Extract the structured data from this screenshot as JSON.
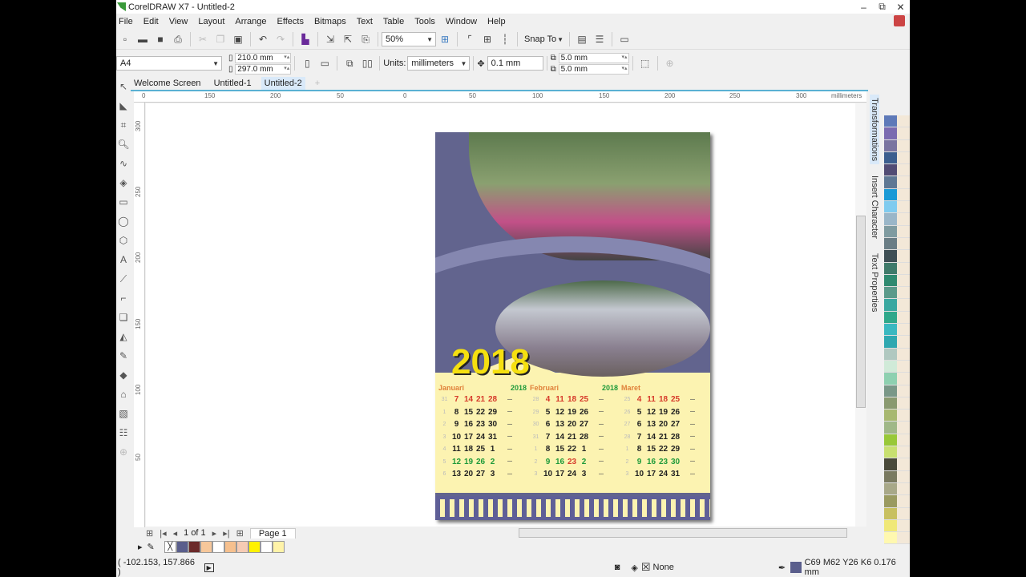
{
  "window": {
    "title": "CorelDRAW X7 - Untitled-2",
    "minimize": "–",
    "restore": "⧉",
    "close": "✕"
  },
  "menu": [
    "File",
    "Edit",
    "View",
    "Layout",
    "Arrange",
    "Effects",
    "Bitmaps",
    "Text",
    "Table",
    "Tools",
    "Window",
    "Help"
  ],
  "toolbar": {
    "zoom_value": "50%",
    "snap_label": "Snap To"
  },
  "property_bar": {
    "page_size": "A4",
    "width": "210.0 mm",
    "height": "297.0 mm",
    "units_label": "Units:",
    "units_value": "millimeters",
    "nudge": "0.1 mm",
    "dup_x": "5.0 mm",
    "dup_y": "5.0 mm"
  },
  "tabs": [
    {
      "label": "Welcome Screen"
    },
    {
      "label": "Untitled-1"
    },
    {
      "label": "Untitled-2"
    }
  ],
  "ruler": {
    "h_ticks": [
      "0",
      "150",
      "200",
      "50",
      "0",
      "50",
      "100",
      "150",
      "200",
      "250",
      "300"
    ],
    "units": "millimeters",
    "v_ticks": [
      "300",
      "250",
      "200",
      "150",
      "100",
      "50"
    ]
  },
  "calendar": {
    "year": "2018",
    "months": [
      {
        "name": "Januari",
        "yr": "2018",
        "rows": [
          [
            "31",
            "7",
            "14",
            "21",
            "28"
          ],
          [
            "1",
            "8",
            "15",
            "22",
            "29"
          ],
          [
            "2",
            "9",
            "16",
            "23",
            "30"
          ],
          [
            "3",
            "10",
            "17",
            "24",
            "31"
          ],
          [
            "4",
            "11",
            "18",
            "25",
            "1"
          ],
          [
            "5",
            "12",
            "19",
            "26",
            "2"
          ],
          [
            "6",
            "13",
            "20",
            "27",
            "3"
          ]
        ]
      },
      {
        "name": "Februari",
        "yr": "2018",
        "rows": [
          [
            "28",
            "4",
            "11",
            "18",
            "25"
          ],
          [
            "29",
            "5",
            "12",
            "19",
            "26"
          ],
          [
            "30",
            "6",
            "13",
            "20",
            "27"
          ],
          [
            "31",
            "7",
            "14",
            "21",
            "28"
          ],
          [
            "1",
            "8",
            "15",
            "22",
            "1"
          ],
          [
            "2",
            "9",
            "16",
            "23",
            "2"
          ],
          [
            "3",
            "10",
            "17",
            "24",
            "3"
          ]
        ]
      },
      {
        "name": "Maret",
        "yr": "",
        "rows": [
          [
            "25",
            "4",
            "11",
            "18",
            "25"
          ],
          [
            "26",
            "5",
            "12",
            "19",
            "26"
          ],
          [
            "27",
            "6",
            "13",
            "20",
            "27"
          ],
          [
            "28",
            "7",
            "14",
            "21",
            "28"
          ],
          [
            "1",
            "8",
            "15",
            "22",
            "29"
          ],
          [
            "2",
            "9",
            "16",
            "23",
            "30"
          ],
          [
            "3",
            "10",
            "17",
            "24",
            "31"
          ]
        ]
      }
    ]
  },
  "pager": {
    "count": "1 of 1",
    "page_tab": "Page 1"
  },
  "doc_palette": [
    "none",
    "#5a5e8c",
    "#6b2a2a",
    "#f6c79a",
    "#ffffff",
    "#f6c08e",
    "#f6cbb4",
    "#fff200",
    "#ffffff",
    "#fff3a8"
  ],
  "status": {
    "coords": "( -102.153, 157.866 )",
    "fill": "None",
    "outline": "C69 M62 Y26 K6  0.176 mm",
    "outline_color": "#5a5e8c"
  },
  "dockers": [
    "Transformations",
    "Insert Character",
    "Text Properties"
  ],
  "palette_col1": [
    "#5e79b8",
    "#7b6bb0",
    "#7a74a0",
    "#3c5e8e",
    "#524c74",
    "#5f7894",
    "#1a9ad6",
    "#7fcbef",
    "#9ab6c8",
    "#7f9ba0",
    "#6a7d85",
    "#3f4f55",
    "#3f7a6a",
    "#2f8a70",
    "#5a9a8a",
    "#3aa8a0",
    "#2fa88a",
    "#3ab8c0",
    "#2fa8b0",
    "#b0c8c0",
    "#d0ead8",
    "#8ed0b0",
    "#7a9888",
    "#8a9a70",
    "#a8b870",
    "#a0b888",
    "#98c838",
    "#c8e070",
    "#4a4a3a",
    "#7a7a60",
    "#a8a888",
    "#9a9a60",
    "#c8c060",
    "#f0e878",
    "#fff8b0"
  ]
}
